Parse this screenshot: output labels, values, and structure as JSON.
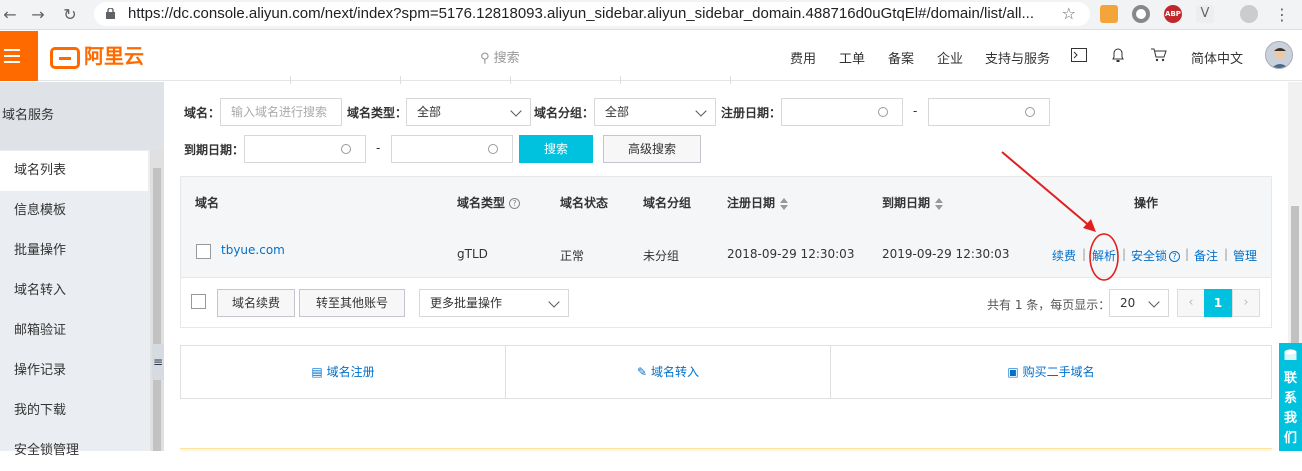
{
  "browser": {
    "url": "https://dc.console.aliyun.com/next/index?spm=5176.12818093.aliyun_sidebar.aliyun_sidebar_domain.488716d0uGtqEl#/domain/list/all...",
    "ext_abp": "ABP"
  },
  "header": {
    "logo_text": "阿里云",
    "search_placeholder": "搜索",
    "nav": [
      "费用",
      "工单",
      "备案",
      "企业",
      "支持与服务"
    ],
    "language": "简体中文"
  },
  "sidebar": {
    "title": "域名服务",
    "items": [
      "域名列表",
      "信息模板",
      "批量操作",
      "域名转入",
      "邮箱验证",
      "操作记录",
      "我的下载",
      "安全锁管理"
    ],
    "active_index": 0
  },
  "filters": {
    "domain_label": "域名：",
    "domain_placeholder": "输入域名进行搜索",
    "type_label": "域名类型：",
    "type_value": "全部",
    "group_label": "域名分组：",
    "group_value": "全部",
    "reg_date_label": "注册日期：",
    "exp_date_label": "到期日期：",
    "dash": "-",
    "search_button": "搜索",
    "advanced_button": "高级搜索"
  },
  "table": {
    "headers": {
      "domain": "域名",
      "type": "域名类型",
      "status": "域名状态",
      "group": "域名分组",
      "reg_date": "注册日期",
      "exp_date": "到期日期",
      "actions": "操作"
    },
    "rows": [
      {
        "domain": "tbyue.com",
        "type": "gTLD",
        "status": "正常",
        "group": "未分组",
        "reg_date": "2018-09-29 12:30:03",
        "exp_date": "2019-09-29 12:30:03",
        "actions": [
          "续费",
          "解析",
          "安全锁",
          "备注",
          "管理"
        ]
      }
    ],
    "action_sep": "|"
  },
  "batch": {
    "renew_button": "域名续费",
    "transfer_button": "转至其他账号",
    "more_select": "更多批量操作",
    "summary": "共有 1 条，每页显示：",
    "page_size": "20",
    "prev": "‹",
    "current_page": "1",
    "next": "›"
  },
  "quick_links": [
    "域名注册",
    "域名转入",
    "购买二手域名"
  ],
  "contact": "联系我们"
}
